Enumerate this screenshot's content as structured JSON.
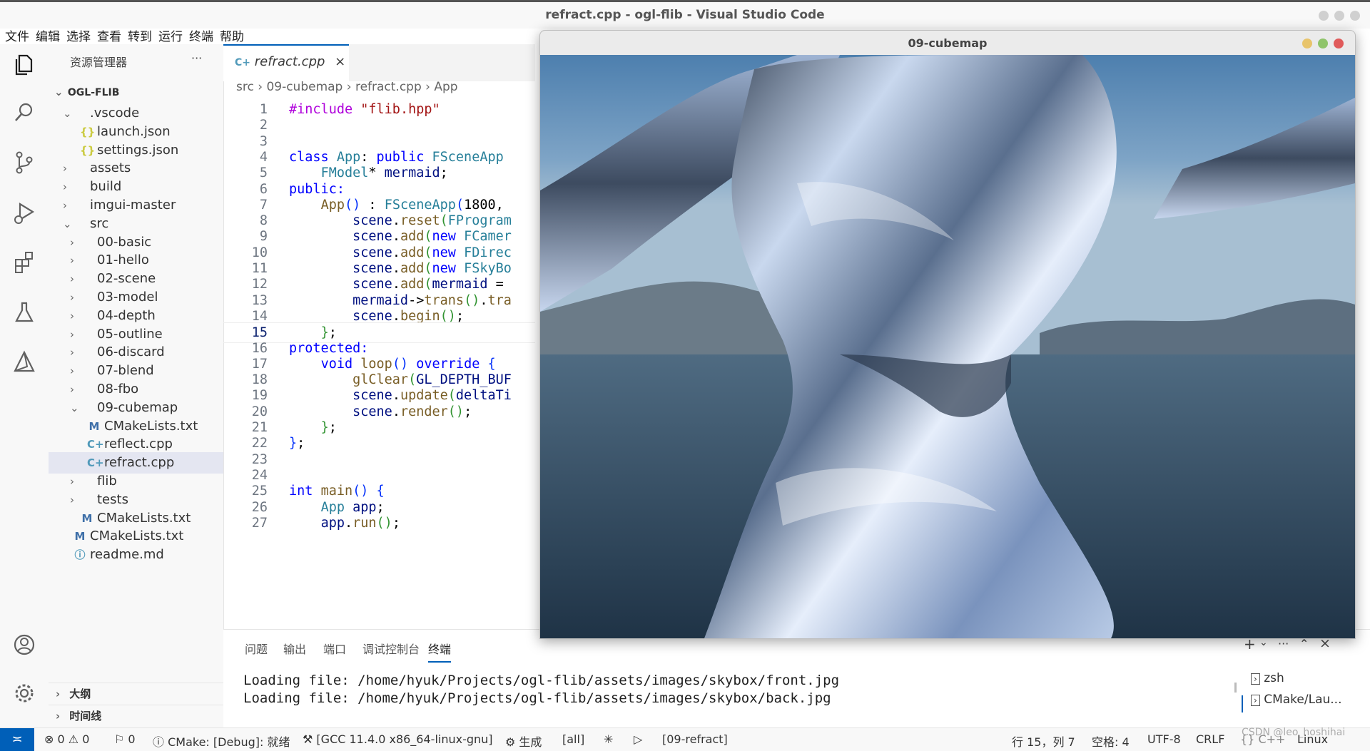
{
  "window": {
    "title": "refract.cpp - ogl-flib - Visual Studio Code"
  },
  "menu": [
    "文件",
    "编辑",
    "选择",
    "查看",
    "转到",
    "运行",
    "终端",
    "帮助"
  ],
  "explorer": {
    "title": "资源管理器",
    "more": "···",
    "root": "OGL-FLIB",
    "items": [
      {
        "label": ".vscode",
        "chev": "⌄",
        "icon": "",
        "color": "#333"
      },
      {
        "label": "launch.json",
        "chev": "",
        "icon": "{}",
        "color": "#cbcb41"
      },
      {
        "label": "settings.json",
        "chev": "",
        "icon": "{}",
        "color": "#cbcb41"
      },
      {
        "label": "assets",
        "chev": "›",
        "icon": "",
        "color": "#333"
      },
      {
        "label": "build",
        "chev": "›",
        "icon": "",
        "color": "#333"
      },
      {
        "label": "imgui-master",
        "chev": "›",
        "icon": "",
        "color": "#333"
      },
      {
        "label": "src",
        "chev": "⌄",
        "icon": "",
        "color": "#333"
      },
      {
        "label": "00-basic",
        "chev": "›",
        "icon": "",
        "color": "#333"
      },
      {
        "label": "01-hello",
        "chev": "›",
        "icon": "",
        "color": "#333"
      },
      {
        "label": "02-scene",
        "chev": "›",
        "icon": "",
        "color": "#333"
      },
      {
        "label": "03-model",
        "chev": "›",
        "icon": "",
        "color": "#333"
      },
      {
        "label": "04-depth",
        "chev": "›",
        "icon": "",
        "color": "#333"
      },
      {
        "label": "05-outline",
        "chev": "›",
        "icon": "",
        "color": "#333"
      },
      {
        "label": "06-discard",
        "chev": "›",
        "icon": "",
        "color": "#333"
      },
      {
        "label": "07-blend",
        "chev": "›",
        "icon": "",
        "color": "#333"
      },
      {
        "label": "08-fbo",
        "chev": "›",
        "icon": "",
        "color": "#333"
      },
      {
        "label": "09-cubemap",
        "chev": "⌄",
        "icon": "",
        "color": "#333"
      },
      {
        "label": "CMakeLists.txt",
        "chev": "",
        "icon": "M",
        "color": "#3e6fa8"
      },
      {
        "label": "reflect.cpp",
        "chev": "",
        "icon": "C+",
        "color": "#519aba"
      },
      {
        "label": "refract.cpp",
        "chev": "",
        "icon": "C+",
        "color": "#519aba"
      },
      {
        "label": "flib",
        "chev": "›",
        "icon": "",
        "color": "#333"
      },
      {
        "label": "tests",
        "chev": "›",
        "icon": "",
        "color": "#333"
      },
      {
        "label": "CMakeLists.txt",
        "chev": "",
        "icon": "M",
        "color": "#3e6fa8"
      },
      {
        "label": "CMakeLists.txt",
        "chev": "",
        "icon": "M",
        "color": "#3e6fa8"
      },
      {
        "label": "readme.md",
        "chev": "",
        "icon": "ⓘ",
        "color": "#519aba"
      }
    ],
    "outline": "大纲",
    "timeline": "时间线"
  },
  "editor": {
    "tab": "refract.cpp",
    "close": "×",
    "breadcrumbs": [
      "src",
      "09-cubemap",
      "refract.cpp",
      "App"
    ],
    "lines": [
      {
        "n": "1",
        "tokens": [
          [
            "pp",
            "#include "
          ],
          [
            "str",
            "\"flib.hpp\""
          ]
        ]
      },
      {
        "n": "2",
        "tokens": []
      },
      {
        "n": "3",
        "tokens": []
      },
      {
        "n": "4",
        "tokens": [
          [
            "kw",
            "class "
          ],
          [
            "ty",
            "App"
          ],
          [
            "pl",
            ": "
          ],
          [
            "kw",
            "public "
          ],
          [
            "ty",
            "FSceneApp"
          ]
        ]
      },
      {
        "n": "5",
        "tokens": [
          [
            "pl",
            "    "
          ],
          [
            "ty",
            "FModel"
          ],
          [
            "pl",
            "* "
          ],
          [
            "var",
            "mermaid"
          ],
          [
            "pl",
            ";"
          ]
        ]
      },
      {
        "n": "6",
        "tokens": [
          [
            "kw",
            "public:"
          ]
        ]
      },
      {
        "n": "7",
        "tokens": [
          [
            "pl",
            "    "
          ],
          [
            "fn",
            "App"
          ],
          [
            "br",
            "()"
          ],
          [
            "pl",
            " : "
          ],
          [
            "ty",
            "FSceneApp"
          ],
          [
            "br",
            "("
          ],
          [
            "pl",
            "1800,"
          ]
        ]
      },
      {
        "n": "8",
        "tokens": [
          [
            "pl",
            "        "
          ],
          [
            "var",
            "scene"
          ],
          [
            "pl",
            "."
          ],
          [
            "fn",
            "reset"
          ],
          [
            "br2",
            "("
          ],
          [
            "ty",
            "FProgram"
          ]
        ]
      },
      {
        "n": "9",
        "tokens": [
          [
            "pl",
            "        "
          ],
          [
            "var",
            "scene"
          ],
          [
            "pl",
            "."
          ],
          [
            "fn",
            "add"
          ],
          [
            "br2",
            "("
          ],
          [
            "kw",
            "new "
          ],
          [
            "ty",
            "FCamer"
          ]
        ]
      },
      {
        "n": "10",
        "tokens": [
          [
            "pl",
            "        "
          ],
          [
            "var",
            "scene"
          ],
          [
            "pl",
            "."
          ],
          [
            "fn",
            "add"
          ],
          [
            "br2",
            "("
          ],
          [
            "kw",
            "new "
          ],
          [
            "ty",
            "FDirec"
          ]
        ]
      },
      {
        "n": "11",
        "tokens": [
          [
            "pl",
            "        "
          ],
          [
            "var",
            "scene"
          ],
          [
            "pl",
            "."
          ],
          [
            "fn",
            "add"
          ],
          [
            "br2",
            "("
          ],
          [
            "kw",
            "new "
          ],
          [
            "ty",
            "FSkyBo"
          ]
        ]
      },
      {
        "n": "12",
        "tokens": [
          [
            "pl",
            "        "
          ],
          [
            "var",
            "scene"
          ],
          [
            "pl",
            "."
          ],
          [
            "fn",
            "add"
          ],
          [
            "br2",
            "("
          ],
          [
            "var",
            "mermaid"
          ],
          [
            "pl",
            " ="
          ]
        ]
      },
      {
        "n": "13",
        "tokens": [
          [
            "pl",
            "        "
          ],
          [
            "var",
            "mermaid"
          ],
          [
            "pl",
            "->"
          ],
          [
            "fn",
            "trans"
          ],
          [
            "br2",
            "()"
          ],
          [
            "pl",
            "."
          ],
          [
            "fn",
            "tra"
          ]
        ]
      },
      {
        "n": "14",
        "tokens": [
          [
            "pl",
            "        "
          ],
          [
            "var",
            "scene"
          ],
          [
            "pl",
            "."
          ],
          [
            "fn",
            "begin"
          ],
          [
            "br2",
            "()"
          ],
          [
            "pl",
            ";"
          ]
        ]
      },
      {
        "n": "15",
        "tokens": [
          [
            "pl",
            "    "
          ],
          [
            "br2",
            "}"
          ],
          [
            "pl",
            ";"
          ]
        ],
        "current": true
      },
      {
        "n": "16",
        "tokens": [
          [
            "kw",
            "protected:"
          ]
        ]
      },
      {
        "n": "17",
        "tokens": [
          [
            "pl",
            "    "
          ],
          [
            "kw",
            "void "
          ],
          [
            "fn",
            "loop"
          ],
          [
            "br",
            "()"
          ],
          [
            "kw",
            " override "
          ],
          [
            "br",
            "{"
          ]
        ]
      },
      {
        "n": "18",
        "tokens": [
          [
            "pl",
            "        "
          ],
          [
            "fn",
            "glClear"
          ],
          [
            "br2",
            "("
          ],
          [
            "var",
            "GL_DEPTH_BUF"
          ]
        ]
      },
      {
        "n": "19",
        "tokens": [
          [
            "pl",
            "        "
          ],
          [
            "var",
            "scene"
          ],
          [
            "pl",
            "."
          ],
          [
            "fn",
            "update"
          ],
          [
            "br2",
            "("
          ],
          [
            "var",
            "deltaTi"
          ]
        ]
      },
      {
        "n": "20",
        "tokens": [
          [
            "pl",
            "        "
          ],
          [
            "var",
            "scene"
          ],
          [
            "pl",
            "."
          ],
          [
            "fn",
            "render"
          ],
          [
            "br2",
            "()"
          ],
          [
            "pl",
            ";"
          ]
        ]
      },
      {
        "n": "21",
        "tokens": [
          [
            "pl",
            "    "
          ],
          [
            "br2",
            "}"
          ],
          [
            "pl",
            ";"
          ]
        ]
      },
      {
        "n": "22",
        "tokens": [
          [
            "br",
            "}"
          ],
          [
            "pl",
            ";"
          ]
        ]
      },
      {
        "n": "23",
        "tokens": []
      },
      {
        "n": "24",
        "tokens": []
      },
      {
        "n": "25",
        "tokens": [
          [
            "kw",
            "int "
          ],
          [
            "fn",
            "main"
          ],
          [
            "br",
            "()"
          ],
          [
            "pl",
            " "
          ],
          [
            "br",
            "{"
          ]
        ]
      },
      {
        "n": "26",
        "tokens": [
          [
            "pl",
            "    "
          ],
          [
            "ty",
            "App"
          ],
          [
            "pl",
            " "
          ],
          [
            "var",
            "app"
          ],
          [
            "pl",
            ";"
          ]
        ]
      },
      {
        "n": "27",
        "tokens": [
          [
            "pl",
            "    "
          ],
          [
            "var",
            "app"
          ],
          [
            "pl",
            "."
          ],
          [
            "fn",
            "run"
          ],
          [
            "br2",
            "()"
          ],
          [
            "pl",
            ";"
          ]
        ]
      }
    ]
  },
  "panel": {
    "tabs": [
      "问题",
      "输出",
      "端口",
      "调试控制台",
      "终端"
    ],
    "active_tab": "终端",
    "terminal_lines": [
      "Loading file: /home/hyuk/Projects/ogl-flib/assets/images/skybox/front.jpg",
      "Loading file: /home/hyuk/Projects/ogl-flib/assets/images/skybox/back.jpg"
    ],
    "terminals": [
      "zsh",
      "CMake/Lau..."
    ],
    "actions": [
      "+",
      "⌄",
      "···",
      "⌃",
      "×"
    ]
  },
  "overlay_window": {
    "title": "09-cubemap"
  },
  "statusbar": {
    "remote": "≍",
    "errors": "⊗ 0 ⚠ 0",
    "ports": "⚐ 0",
    "cmake": "ⓘ CMake: [Debug]: 就绪",
    "kit": "⚒ [GCC 11.4.0 x86_64-linux-gnu]",
    "build": "⚙ 生成",
    "target": "[all]",
    "debug": "✳",
    "run": "▷",
    "launch_target": "[09-refract]",
    "position": "行 15，列 7",
    "spaces": "空格: 4",
    "encoding": "UTF-8",
    "eol": "CRLF",
    "lang": "{} C++",
    "os": "Linux",
    "watermark": "CSDN @leo_hoshihai"
  },
  "colors": {
    "accent": "#005fb8",
    "selection": "#e4e6f1"
  }
}
